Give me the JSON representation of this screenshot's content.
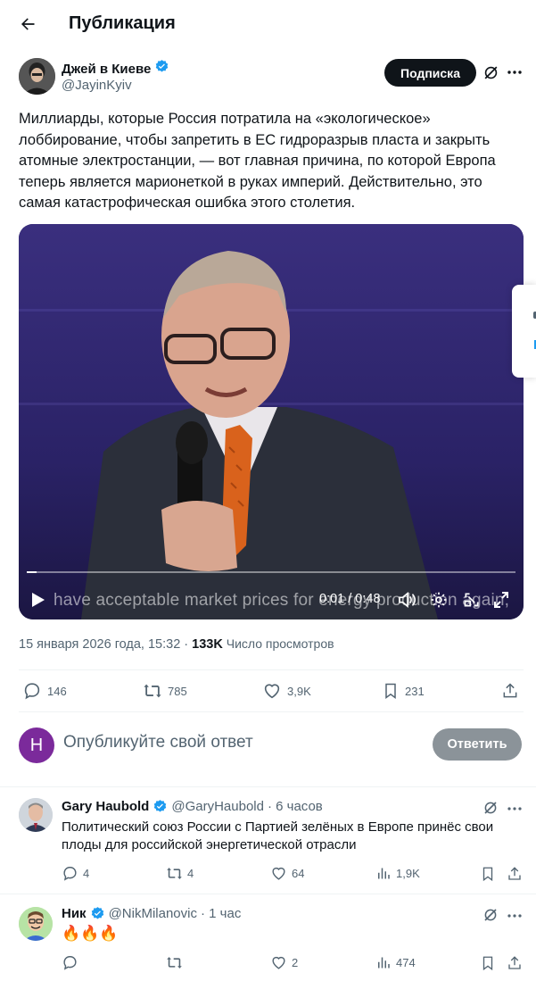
{
  "header": {
    "title": "Публикация"
  },
  "author": {
    "name": "Джей в Киеве",
    "handle": "@JayinKyiv"
  },
  "follow_label": "Подписка",
  "post": {
    "lines": [
      "Миллиарды, которые Россия потратила на «экологическое»",
      "лоббирование, чтобы запретить в ЕС гидроразрыв пласта и закрыть",
      "атомные электростанции, — вот главная причина, по которой Европа",
      "теперь является марионеткой в руках империй. Действительно, это",
      "самая катастрофическая ошибка этого столетия."
    ]
  },
  "video": {
    "subtitle": "have acceptable market prices for energy production again,",
    "time": "0:01 / 0:48",
    "progress": 0.02
  },
  "meta": {
    "date": "15 января 2026 года, 15:32",
    "sep": " · ",
    "views": "133K",
    "views_label": " Число просмотров"
  },
  "actions": {
    "replies": "146",
    "reposts": "785",
    "likes": "3,9K",
    "bookmarks": "231"
  },
  "composer": {
    "avatar_letter": "H",
    "placeholder": "Опубликуйте свой ответ",
    "button": "Ответить"
  },
  "comments": [
    {
      "name": "Gary Haubold",
      "handle": "@GaryHaubold",
      "time": "· 6 часов",
      "lines": [
        "Политический союз России с Партией зелёных в Европе принёс свои",
        "плоды для российской энергетической отрасли"
      ],
      "replies": "4",
      "reposts": "4",
      "likes": "64",
      "views": "1,9K"
    },
    {
      "name": "Ник",
      "handle": "@NikMilanovic",
      "time": "· 1 час",
      "lines": [
        "🔥🔥🔥"
      ],
      "replies": "",
      "reposts": "",
      "likes": "2",
      "views": "474"
    }
  ],
  "colors": {
    "verified": "#1d9bf0",
    "follow_bg": "#0f1419",
    "reply_btn": "#8b9399",
    "composer_avatar": "#7b2a9b",
    "muted": "#536471"
  }
}
